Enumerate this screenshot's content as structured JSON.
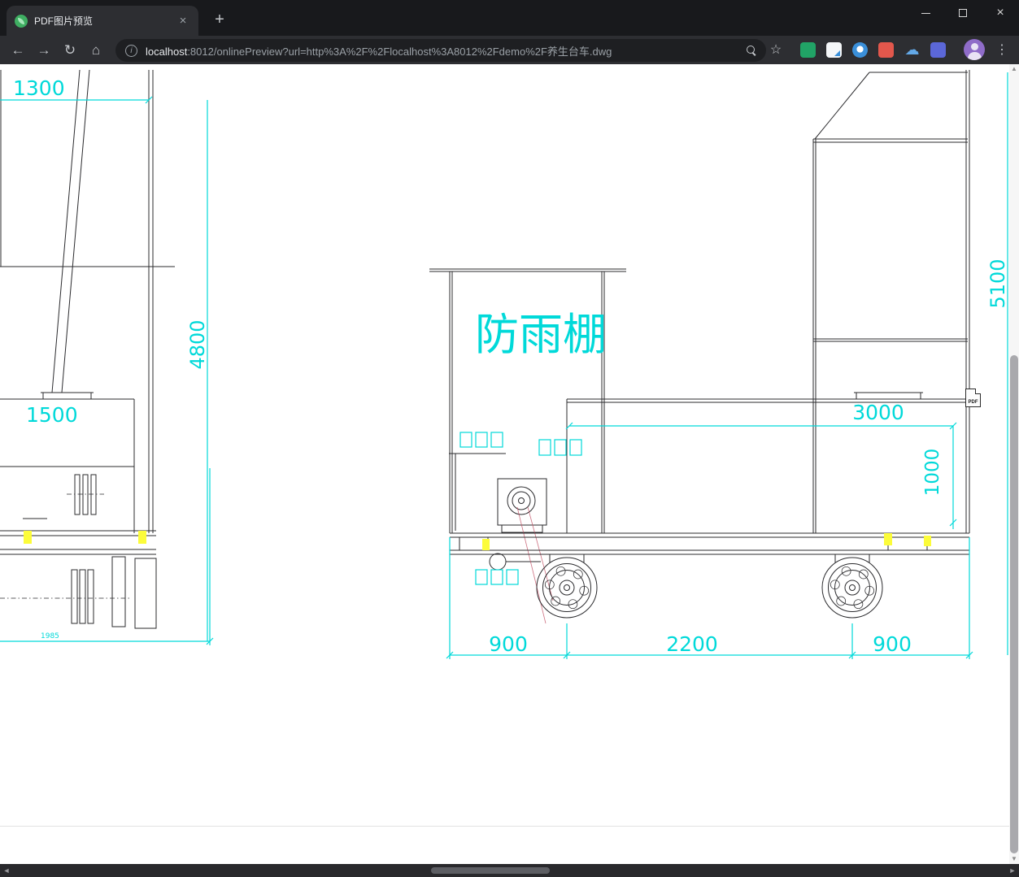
{
  "browser": {
    "tab_title": "PDF图片预览",
    "tab_close": "×",
    "new_tab": "+",
    "window_controls": {
      "close": "×"
    },
    "nav": {
      "back": "←",
      "forward": "→",
      "reload": "↻",
      "home": "⌂"
    },
    "omnibox": {
      "info_letter": "i",
      "host": "localhost",
      "path": ":8012/onlinePreview?url=http%3A%2F%2Flocalhost%3A8012%2Fdemo%2F养生台车.dwg",
      "star": "☆"
    },
    "menu_dots": "⋮",
    "extension_icons": {
      "cloud": "☁"
    }
  },
  "drawing": {
    "labels": {
      "dim_top_left": "1300",
      "dim_height_left": "4800",
      "dim_left_width": "1500",
      "dim_small_left": "1985",
      "shelter_text": "防雨棚",
      "dim_total_height": "5100",
      "dim_deck_length": "3000",
      "dim_deck_height": "1000",
      "dim_span_left": "900",
      "dim_span_center": "2200",
      "dim_span_right": "900"
    },
    "colors": {
      "dimension_cyan": "#00d9d9",
      "drawing_line": "#2b2b2e",
      "highlight_yellow": "#fcfc3a",
      "construction_red": "#c4566a"
    }
  },
  "pdf_badge": "PDF",
  "scrollbar": {
    "up": "▲",
    "down": "▼",
    "left": "◄",
    "right": "►"
  }
}
